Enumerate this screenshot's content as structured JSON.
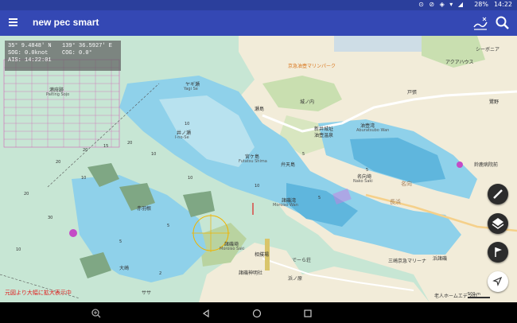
{
  "status_bar": {
    "time": "14:22",
    "battery": "28%",
    "icons": "⊙ ⊘ ◈ ▾ ◢"
  },
  "app_bar": {
    "title": "new pec smart"
  },
  "info_panel": {
    "lat": "35°  9.4848' N",
    "lon": "139°  36.5927' E",
    "sog": "SOG: 0.0knot",
    "cog": "COG: 0.0°",
    "ais": "AIS: 14:22:01"
  },
  "map": {
    "places": [
      {
        "name": "油壺湾",
        "sub": "Aburatsubo Wan"
      },
      {
        "name": "名向埼",
        "sub": "Nako Saki"
      },
      {
        "name": "諸磯湾",
        "sub": "Moroiso Wan"
      },
      {
        "name": "諸磯埼",
        "sub": "Moroiso Saki"
      },
      {
        "name": "宮ケ島",
        "sub": "Futatsu Shima"
      },
      {
        "name": "ヤギ瀬",
        "sub": "Yagi Se"
      },
      {
        "name": "井ノ瀬",
        "sub": "I-no-Se"
      },
      {
        "name": "瀬島"
      },
      {
        "name": "弁天島"
      },
      {
        "name": "港府跡",
        "sub": "Paiting Sojo"
      },
      {
        "name": "名向崎",
        "sub": ""
      },
      {
        "name": "京急油壺マリンパーク"
      },
      {
        "name": "新井城址"
      },
      {
        "name": "油壺温泉"
      },
      {
        "name": "城ノ内"
      },
      {
        "name": "戸張"
      },
      {
        "name": "鷺野"
      },
      {
        "name": "三崎京急マリーナ"
      },
      {
        "name": "諸磯神明社"
      },
      {
        "name": "浜ノ原"
      },
      {
        "name": "老人ホームエデンの"
      },
      {
        "name": "シーボニア"
      },
      {
        "name": "名向"
      },
      {
        "name": "長浜"
      },
      {
        "name": "大崎"
      },
      {
        "name": "赤羽根"
      },
      {
        "name": "ササ"
      },
      {
        "name": "でーら荘"
      },
      {
        "name": "相撲場"
      },
      {
        "name": "浜諸磯"
      },
      {
        "name": "名向埼"
      },
      {
        "name": "アクアハウス"
      },
      {
        "name": "鈴鹿病院前"
      }
    ],
    "depths": [
      "5",
      "10",
      "20",
      "30",
      "20",
      "10",
      "5",
      "2",
      "5",
      "10",
      "20"
    ],
    "red_notice": "元図より大幅に拡大表示中",
    "scale_label": "500 m"
  },
  "fabs": [
    {
      "icon": "ruler-icon"
    },
    {
      "icon": "layers-icon"
    },
    {
      "icon": "flag-icon"
    },
    {
      "icon": "navigation-arrow-icon"
    }
  ],
  "nav_bar": {
    "zoom": "⊕",
    "back": "◁",
    "home": "○",
    "recent": "□"
  }
}
